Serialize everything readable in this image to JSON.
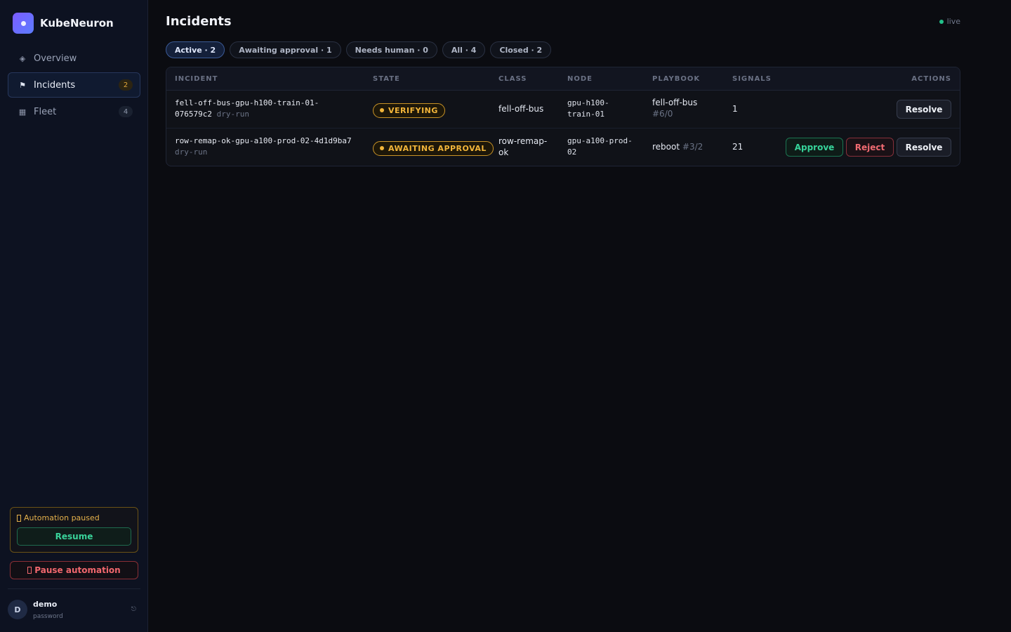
{
  "app": {
    "name": "KubeNeuron"
  },
  "sidebar": {
    "items": [
      {
        "label": "Overview",
        "icon": "◈",
        "badge": ""
      },
      {
        "label": "Incidents",
        "icon": "⚑",
        "badge": "2"
      },
      {
        "label": "Fleet",
        "icon": "▦",
        "badge": "4"
      }
    ],
    "paused_text": "Automation paused",
    "resume_label": "Resume",
    "pause_label": "Pause automation",
    "user": {
      "initial": "D",
      "name": "demo",
      "sub": "password"
    }
  },
  "page": {
    "title": "Incidents",
    "live_label": "live"
  },
  "filters": [
    "Active · 2",
    "Awaiting approval · 1",
    "Needs human · 0",
    "All · 4",
    "Closed · 2"
  ],
  "table": {
    "headers": [
      "INCIDENT",
      "STATE",
      "CLASS",
      "NODE",
      "PLAYBOOK",
      "SIGNALS",
      "ACTIONS"
    ],
    "rows": [
      {
        "id_line1": "fell-off-bus-gpu-h100-train-01-",
        "id_line2": "076579c2",
        "mode": "dry-run",
        "state": "VERIFYING",
        "class": "fell-off-bus",
        "node_line1": "gpu-h100-",
        "node_line2": "train-01",
        "playbook": "fell-off-bus",
        "playbook_step": "#6/0",
        "signals": "1",
        "resolve_label": "Resolve"
      },
      {
        "id_line1": "row-remap-ok-gpu-a100-prod-02-4d1d9ba7",
        "mode": "dry-run",
        "state": "AWAITING APPROVAL",
        "class_line1": "row-remap-",
        "class_line2": "ok",
        "node_line1": "gpu-a100-prod-",
        "node_line2": "02",
        "playbook": "reboot",
        "playbook_step": "#3/2",
        "signals": "21",
        "approve_label": "Approve",
        "reject_label": "Reject",
        "resolve_label": "Resolve"
      }
    ]
  },
  "colors": {
    "accent": "#7c5cff",
    "warning": "#f2b53a",
    "success": "#36d49a",
    "danger": "#f06a71"
  }
}
